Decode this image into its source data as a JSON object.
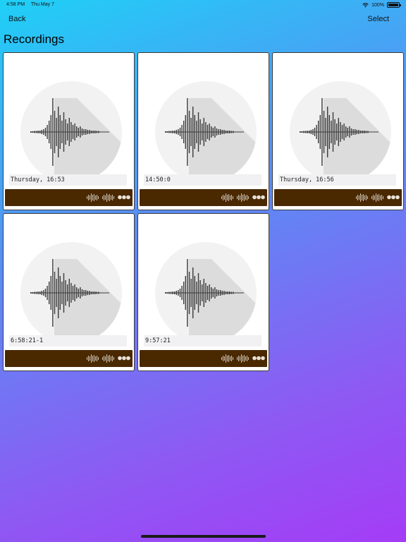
{
  "status_bar": {
    "time": "4:58 PM",
    "date": "Thu May 7",
    "battery": "100%"
  },
  "nav": {
    "back_label": "Back",
    "select_label": "Select"
  },
  "page": {
    "title": "Recordings"
  },
  "recordings": [
    {
      "label": "Thursday, 16:53"
    },
    {
      "label": "14:50:0"
    },
    {
      "label": "Thursday, 16:56"
    },
    {
      "label": "6:58:21-1"
    },
    {
      "label": "9:57:21"
    }
  ],
  "colors": {
    "toolbar": "#4a2800",
    "accent_gradient_start": "#1fd0f6",
    "accent_gradient_end": "#a43cf6"
  },
  "icons": {
    "wave": "waveform-icon",
    "more": "more-icon"
  }
}
